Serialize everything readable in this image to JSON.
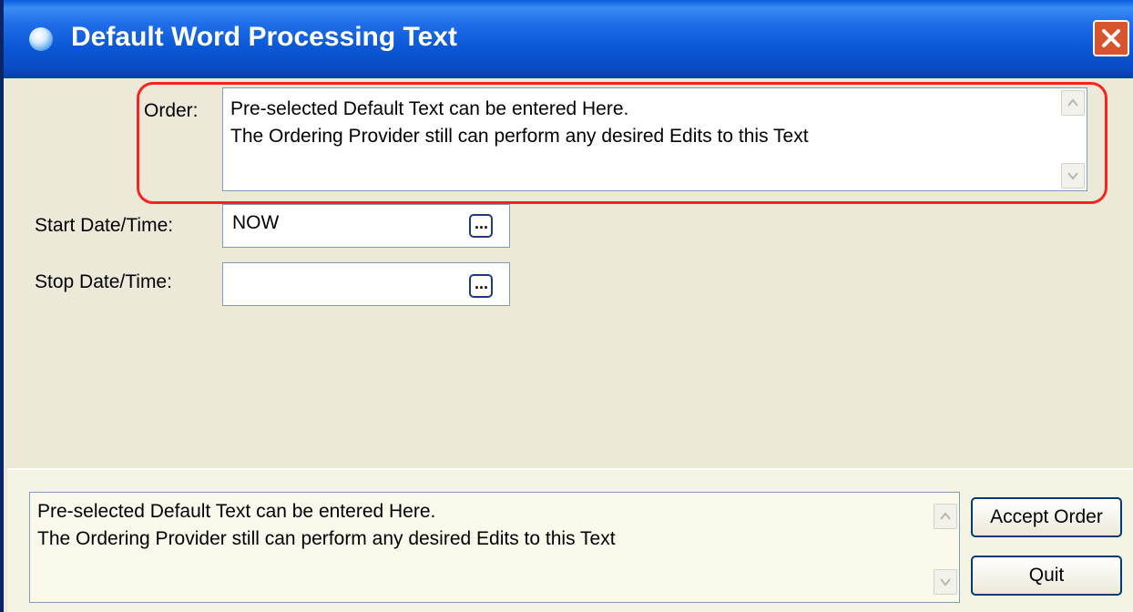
{
  "window": {
    "title": "Default Word Processing Text"
  },
  "icons": {
    "app": "app-globe-icon",
    "close": "close-x-icon",
    "scroll_up": "chevron-up-icon",
    "scroll_down": "chevron-down-icon",
    "ellipsis": "ellipsis-icon"
  },
  "order": {
    "label": "Order:",
    "text": "Pre-selected Default Text can be entered Here.\nThe Ordering Provider still can perform any desired Edits to this Text"
  },
  "start": {
    "label": "Start Date/Time:",
    "value": "NOW",
    "button": "..."
  },
  "stop": {
    "label": "Stop Date/Time:",
    "value": "",
    "button": "..."
  },
  "preview": {
    "text": "Pre-selected Default Text can be entered Here.\nThe Ordering Provider still can perform any desired Edits to this Text"
  },
  "buttons": {
    "accept": "Accept Order",
    "quit": "Quit"
  },
  "colors": {
    "titlebar": "#0a58d6",
    "highlight": "#ff2020",
    "close": "#d8542e",
    "dialog_bg": "#ece9d8"
  }
}
